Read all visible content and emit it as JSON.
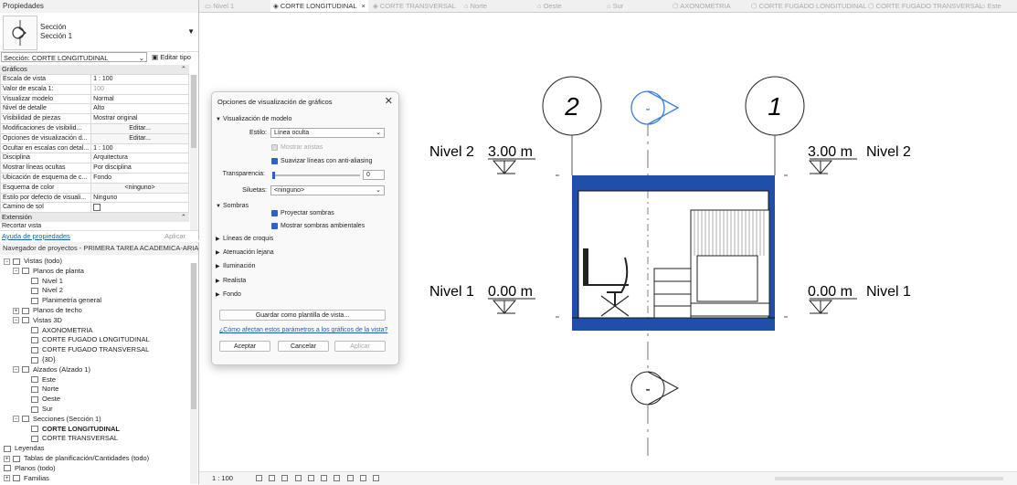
{
  "properties": {
    "title": "Propiedades",
    "type_line1": "Sección",
    "type_line2": "Sección 1",
    "selector": "Sección: CORTE LONGITUDINAL",
    "edit_type": "Editar tipo",
    "group_graficos": "Gráficos",
    "rows": [
      {
        "k": "Escala de vista",
        "v": "1 : 100"
      },
      {
        "k": "Valor de escala   1:",
        "v": "100"
      },
      {
        "k": "Visualizar modelo",
        "v": "Normal"
      },
      {
        "k": "Nivel de detalle",
        "v": "Alto"
      },
      {
        "k": "Visibilidad de piezas",
        "v": "Mostrar original"
      },
      {
        "k": "Modificaciones de visibilid...",
        "v": "Editar..."
      },
      {
        "k": "Opciones de visualización d...",
        "v": "Editar..."
      },
      {
        "k": "Ocultar en escalas con detal...",
        "v": "1 : 100"
      },
      {
        "k": "Disciplina",
        "v": "Arquitectura"
      },
      {
        "k": "Mostrar líneas ocultas",
        "v": "Por disciplina"
      },
      {
        "k": "Ubicación de esquema de c...",
        "v": "Fondo"
      },
      {
        "k": "Esquema de color",
        "v": "<ninguno>"
      },
      {
        "k": "Estilo por defecto de visuali...",
        "v": "Ninguno"
      },
      {
        "k": "Camino de sol",
        "v": ""
      }
    ],
    "group_extension": "Extensión",
    "cut_row": "Recortar vista",
    "help_link": "Ayuda de propiedades",
    "apply": "Aplicar"
  },
  "browser": {
    "title": "Navegador de proyectos - PRIMERA TAREA ACADEMICA-ARIAN...",
    "nodes": [
      {
        "label": "Vistas (todo)",
        "exp": "−"
      },
      {
        "label": "Planos de planta",
        "exp": "−"
      },
      {
        "label": "Nivel 1"
      },
      {
        "label": "Nivel 2"
      },
      {
        "label": "Planimetría general"
      },
      {
        "label": "Planos de techo",
        "exp": "+"
      },
      {
        "label": "Vistas 3D",
        "exp": "−"
      },
      {
        "label": "AXONOMETRIA"
      },
      {
        "label": "CORTE FUGADO LONGITUDINAL"
      },
      {
        "label": "CORTE FUGADO TRANSVERSAL"
      },
      {
        "label": "{3D}"
      },
      {
        "label": "Alzados (Alzado 1)",
        "exp": "−"
      },
      {
        "label": "Este"
      },
      {
        "label": "Norte"
      },
      {
        "label": "Oeste"
      },
      {
        "label": "Sur"
      },
      {
        "label": "Secciones (Sección 1)",
        "exp": "−"
      },
      {
        "label": "CORTE LONGITUDINAL"
      },
      {
        "label": "CORTE TRANSVERSAL"
      },
      {
        "label": "Leyendas"
      },
      {
        "label": "Tablas de planificación/Cantidades (todo)",
        "exp": "+"
      },
      {
        "label": "Planos (todo)"
      },
      {
        "label": "Familias",
        "exp": "+"
      }
    ]
  },
  "tabs": [
    {
      "label": "Nivel 1"
    },
    {
      "label": "CORTE LONGITUDINAL",
      "close": "×"
    },
    {
      "label": "CORTE TRANSVERSAL"
    },
    {
      "label": "Norte"
    },
    {
      "label": "Oeste"
    },
    {
      "label": "Sur"
    },
    {
      "label": "AXONOMETRIA"
    },
    {
      "label": "CORTE FUGADO LONGITUDINAL"
    },
    {
      "label": "CORTE FUGADO TRANSVERSAL"
    },
    {
      "label": "Este"
    }
  ],
  "drawing": {
    "bubble_left": "2",
    "bubble_right": "1",
    "level2_left": "Nivel 2",
    "level2_left_val": "3.00 m",
    "level2_right_val": "3.00 m",
    "level2_right": "Nivel 2",
    "level1_left": "Nivel 1",
    "level1_left_val": "0.00 m",
    "level1_right_val": "0.00 m",
    "level1_right": "Nivel 1",
    "section_mark": "-",
    "accent": "#1f4fa8"
  },
  "dialog": {
    "title": "Opciones de visualización de gráficos",
    "close": "✕",
    "sec_model": "Visualización de modelo",
    "style_label": "Estilo:",
    "style_value": "Línea oculta",
    "show_edges": "Mostrar aristas",
    "antialias": "Suavizar líneas con anti-aliasing",
    "transparency_label": "Transparencia:",
    "transparency_value": "0",
    "silhouettes_label": "Siluetas:",
    "silhouettes_value": "<ninguno>",
    "sec_shadows": "Sombras",
    "cast_shadows": "Proyectar sombras",
    "ambient_shadows": "Mostrar sombras ambientales",
    "sec_sketch": "Líneas de croquis",
    "sec_far": "Atenuación lejana",
    "sec_light": "Iluminación",
    "sec_realistic": "Realista",
    "sec_background": "Fondo",
    "save_template": "Guardar como plantilla de vista...",
    "help_link": "¿Cómo afectan estos parámetros a los gráficos de la vista?",
    "accept": "Aceptar",
    "cancel": "Cancelar",
    "apply": "Aplicar"
  },
  "status": {
    "scale": "1 : 100"
  }
}
